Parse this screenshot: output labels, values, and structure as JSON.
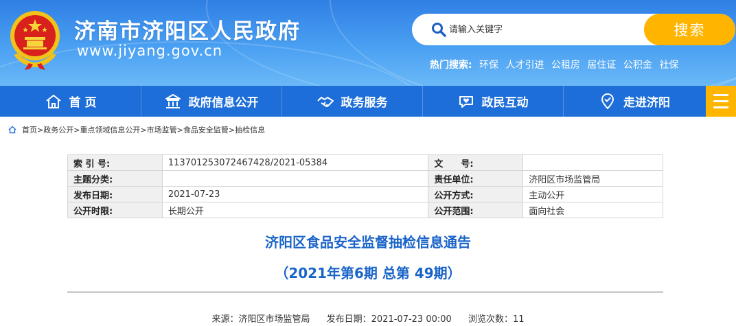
{
  "header": {
    "title": "济南市济阳区人民政府",
    "domain": "www.jiyang.gov.cn",
    "emblem_icon": "national-emblem-icon"
  },
  "search": {
    "placeholder": "请输入关键字",
    "button_label": "搜索",
    "icon": "search-icon"
  },
  "hot_search": {
    "label": "热门搜索:",
    "items": [
      "环保",
      "人才引进",
      "公租房",
      "居住证",
      "公积金",
      "社保"
    ]
  },
  "nav": {
    "items": [
      {
        "label": "首 页",
        "icon": "home-icon"
      },
      {
        "label": "政府信息公开",
        "icon": "government-building-icon"
      },
      {
        "label": "政务服务",
        "icon": "handshake-icon"
      },
      {
        "label": "政民互动",
        "icon": "chat-heart-icon"
      },
      {
        "label": "走进济阳",
        "icon": "location-pin-icon"
      }
    ],
    "menu_icon": "hamburger-menu-icon"
  },
  "breadcrumb": {
    "items": [
      "首页",
      "政务公开",
      "重点领域信息公开",
      "市场监管",
      "食品安全监管",
      "抽检信息"
    ],
    "separator": ">"
  },
  "meta": {
    "rows": [
      [
        {
          "k": "索 引 号:",
          "v": "113701253072467428/2021-05384"
        },
        {
          "k": "文　　号:",
          "v": ""
        }
      ],
      [
        {
          "k": "主题分类:",
          "v": ""
        },
        {
          "k": "责任单位:",
          "v": "济阳区市场监管局"
        }
      ],
      [
        {
          "k": "发布日期:",
          "v": "2021-07-23"
        },
        {
          "k": "公开方式:",
          "v": "主动公开"
        }
      ],
      [
        {
          "k": "公开时限:",
          "v": "长期公开"
        },
        {
          "k": "公开范围:",
          "v": "面向社会"
        }
      ]
    ]
  },
  "article": {
    "title": "济阳区食品安全监督抽检信息通告",
    "subtitle": "（2021年第6期 总第 49期）",
    "source": "来源：济阳区市场监管局",
    "date": "发布日期：2021-07-23 00:00",
    "views": "浏览次数：11"
  },
  "colors": {
    "header_blue": "#2f7fe4",
    "nav_blue": "#1d6ed8",
    "accent_yellow": "#ffb400",
    "title_blue": "#1a64c8"
  }
}
